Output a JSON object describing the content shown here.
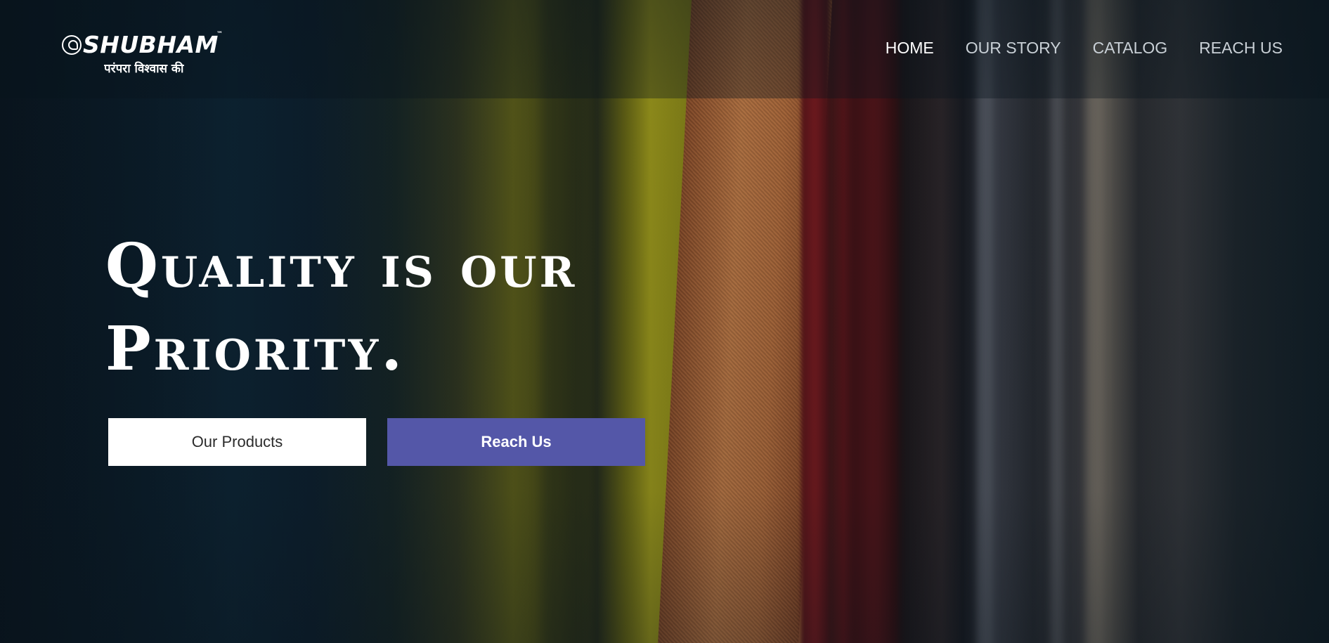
{
  "brand": {
    "name": "SHUBHAM",
    "trademark": "™",
    "tagline": "परंपरा विश्वास की",
    "logo_icon": "shree-seal-icon"
  },
  "nav": {
    "items": [
      {
        "label": "HOME",
        "active": true
      },
      {
        "label": "OUR STORY",
        "active": false
      },
      {
        "label": "CATALOG",
        "active": false
      },
      {
        "label": "REACH US",
        "active": false
      }
    ]
  },
  "hero": {
    "headline_line1": "Quality is our",
    "headline_line2": "Priority.",
    "buttons": {
      "products_label": "Our Products",
      "reach_label": "Reach Us"
    }
  },
  "colors": {
    "accent": "#5457a8",
    "text_light": "#ffffff",
    "nav_inactive": "#c9d0d6",
    "background": "#0b1822"
  }
}
